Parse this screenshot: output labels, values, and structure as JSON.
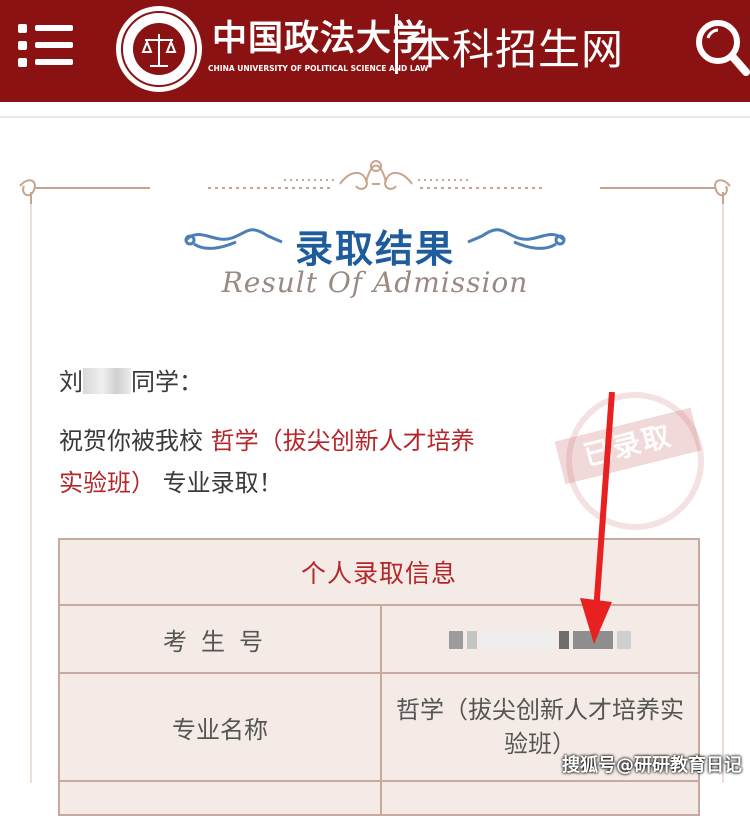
{
  "header": {
    "university_cn": "中国政法大学",
    "university_en": "CHINA UNIVERSITY OF POLITICAL SCIENCE AND LAW",
    "site_title": "本科招生网",
    "menu_icon": "menu-icon",
    "search_icon": "search-icon",
    "brand_color": "#8b1212"
  },
  "certificate": {
    "title_cn": "录取结果",
    "title_en": "Result Of Admission",
    "greeting_prefix": "刘",
    "greeting_suffix": "同学：",
    "congrats_prefix": "祝贺你被我校",
    "major": "哲学（拔尖创新人才培养实验班）",
    "congrats_suffix": "专业录取！",
    "stamp_text": "已录取",
    "title_color": "#1e5c9b",
    "accent_color": "#b5262a"
  },
  "table": {
    "header": "个人录取信息",
    "rows": [
      {
        "label": "考生号",
        "value": ""
      },
      {
        "label": "专业名称",
        "value": "哲学（拔尖创新人才培养实验班）"
      }
    ]
  },
  "watermark": "搜狐号@研研教育日记"
}
